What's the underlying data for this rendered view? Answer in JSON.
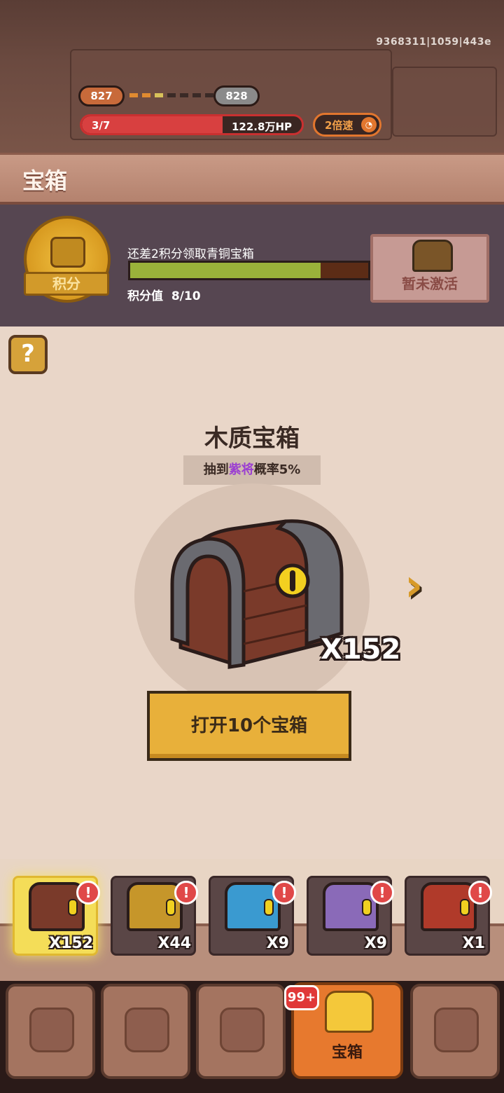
{
  "build_id": "9368311|1059|443e",
  "stage": {
    "current_level": "827",
    "next_level": "828",
    "wave": "3/7",
    "wave_progress": 0.64,
    "boss_hp": "122.8万HP",
    "speed_label": "2倍速"
  },
  "page_title": "宝箱",
  "points": {
    "medal_label": "积分",
    "hint": "还差2积分领取青铜宝箱",
    "progress": 0.8,
    "value_label": "积分值",
    "value": "8/10",
    "locked_chest_label": "暂未激活"
  },
  "help_symbol": "?",
  "selected_chest": {
    "name": "木质宝箱",
    "prob_prefix": "抽到",
    "prob_highlight": "紫将",
    "prob_suffix": "概率5%",
    "count": "X152",
    "next_arrow": "›",
    "open_button": "打开10个宝箱"
  },
  "chest_slots": [
    {
      "name": "wooden-chest",
      "count": "X152",
      "badge": "!",
      "color": "#7a3a2a",
      "selected": true
    },
    {
      "name": "gold-chest",
      "count": "X44",
      "badge": "!",
      "color": "#c6962a",
      "selected": false
    },
    {
      "name": "blue-chest",
      "count": "X9",
      "badge": "!",
      "color": "#3a9ad0",
      "selected": false
    },
    {
      "name": "purple-chest",
      "count": "X9",
      "badge": "!",
      "color": "#8a6ab8",
      "selected": false
    },
    {
      "name": "red-chest",
      "count": "X1",
      "badge": "!",
      "color": "#b03a2a",
      "selected": false
    }
  ],
  "nav": {
    "badge": "99+",
    "tabs": [
      {
        "icon": "hero-icon",
        "label": ""
      },
      {
        "icon": "armor-icon",
        "label": ""
      },
      {
        "icon": "warrior-icon",
        "label": ""
      },
      {
        "icon": "treasure-chest-icon",
        "label": "宝箱"
      },
      {
        "icon": "map-icon",
        "label": ""
      }
    ]
  }
}
